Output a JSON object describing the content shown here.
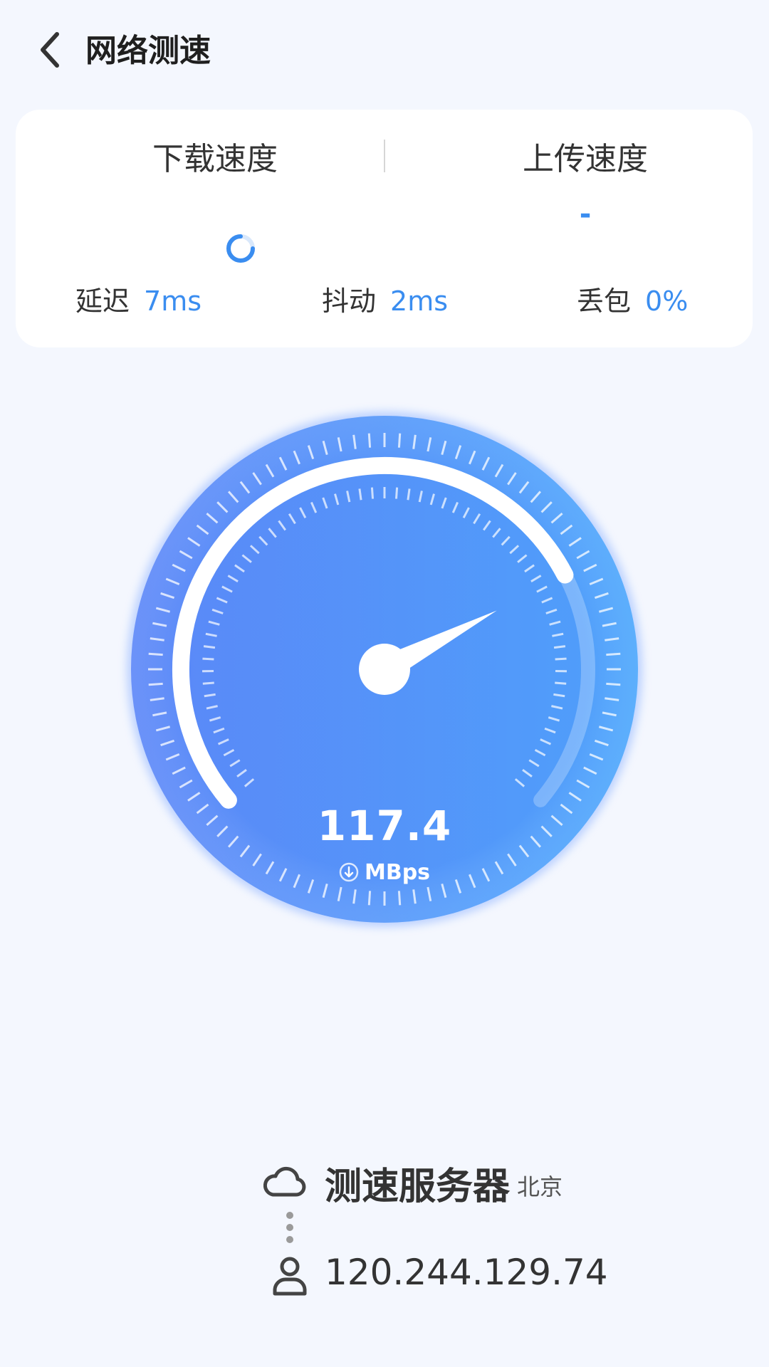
{
  "header": {
    "title": "网络测速",
    "back_icon": "back-chevron-icon"
  },
  "stats_card": {
    "download_label": "下载速度",
    "upload_label": "上传速度",
    "upload_value": "-",
    "download_status_icon": "loading-spinner-icon",
    "metrics": [
      {
        "label": "延迟",
        "value": "7ms"
      },
      {
        "label": "抖动",
        "value": "2ms"
      },
      {
        "label": "丢包",
        "value": "0%"
      }
    ]
  },
  "gauge": {
    "speed": "117.4",
    "unit": "MBps",
    "unit_icon": "download-arrow-icon",
    "progress_fraction": 0.74
  },
  "server": {
    "icon": "cloud-icon",
    "title": "测速服务器",
    "city": "北京"
  },
  "client": {
    "icon": "user-icon",
    "ip": "120.244.129.74"
  },
  "colors": {
    "accent": "#3a8df0",
    "gauge_left": "#5b86f8",
    "gauge_right": "#4aa8fb",
    "background": "#f4f7fe"
  }
}
